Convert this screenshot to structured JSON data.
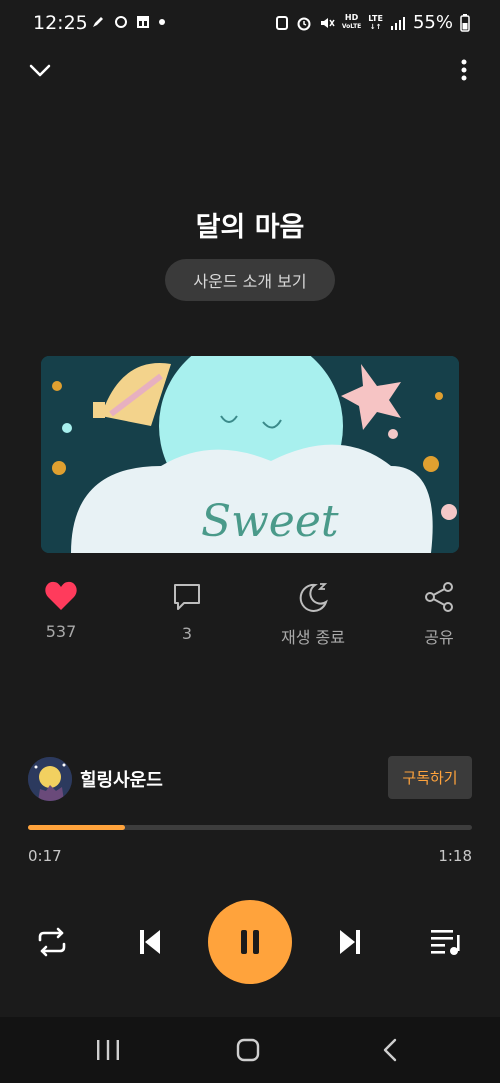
{
  "status_bar": {
    "time": "12:25",
    "battery": "55%",
    "network_label": "LTE",
    "hd_label": "HD"
  },
  "track": {
    "title": "달의 마음",
    "intro_button": "사운드 소개 보기"
  },
  "artwork": {
    "text": "Sweet"
  },
  "actions": {
    "like_count": "537",
    "comment_count": "3",
    "sleep_timer_label": "재생 종료",
    "share_label": "공유"
  },
  "channel": {
    "name": "힐링사운드",
    "subscribe_label": "구독하기"
  },
  "playback": {
    "current_time": "0:17",
    "total_time": "1:18",
    "progress_fraction": 0.218
  },
  "colors": {
    "accent": "#ffa33c",
    "like": "#ff3b5c",
    "background": "#1b1b1b"
  },
  "icons": {
    "collapse": "chevron-down-icon",
    "more": "more-vertical-icon",
    "like": "heart-icon",
    "comment": "comment-icon",
    "sleep": "moon-icon",
    "share": "share-icon",
    "repeat": "repeat-icon",
    "previous": "skip-previous-icon",
    "pause": "pause-icon",
    "next": "skip-next-icon",
    "playlist": "playlist-icon"
  }
}
